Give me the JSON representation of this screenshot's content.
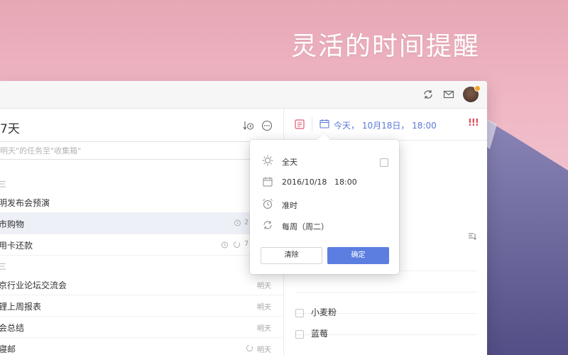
{
  "headline": "灵活的时间提醒",
  "header": {
    "icons": [
      "sync-icon",
      "mail-icon",
      "avatar"
    ]
  },
  "list": {
    "title": "7天",
    "add_placeholder": "明天\"的任务至\"收集箱\"",
    "sections": [
      {
        "label": "三",
        "rows": [
          {
            "text": "明发布会预演",
            "meta": ""
          },
          {
            "text": "市购物",
            "meta": "2"
          },
          {
            "text": "用卡还款",
            "meta": "7"
          }
        ]
      },
      {
        "label": "三",
        "rows": [
          {
            "text": "京行业论坛交流会",
            "meta": "明天"
          },
          {
            "text": "锂上周报表",
            "meta": "明天"
          },
          {
            "text": "会总结",
            "meta": "明天"
          },
          {
            "text": "寝邮",
            "meta": "明天"
          }
        ]
      }
    ]
  },
  "detail": {
    "due_text": "今天，  10月18日，  18:00",
    "priority": "!!!",
    "items": [
      "小麦粉",
      "蓝莓"
    ]
  },
  "popover": {
    "all_day_label": "全天",
    "date_value": "2016/10/18",
    "time_value": "18:00",
    "reminder_label": "准时",
    "repeat_label": "每周（周二）",
    "clear_label": "清除",
    "confirm_label": "确定"
  },
  "colors": {
    "accent": "#5c7ee0",
    "priority": "#e24a56",
    "list_icon": "#e25a74",
    "selected_row": "#eef0f8"
  }
}
